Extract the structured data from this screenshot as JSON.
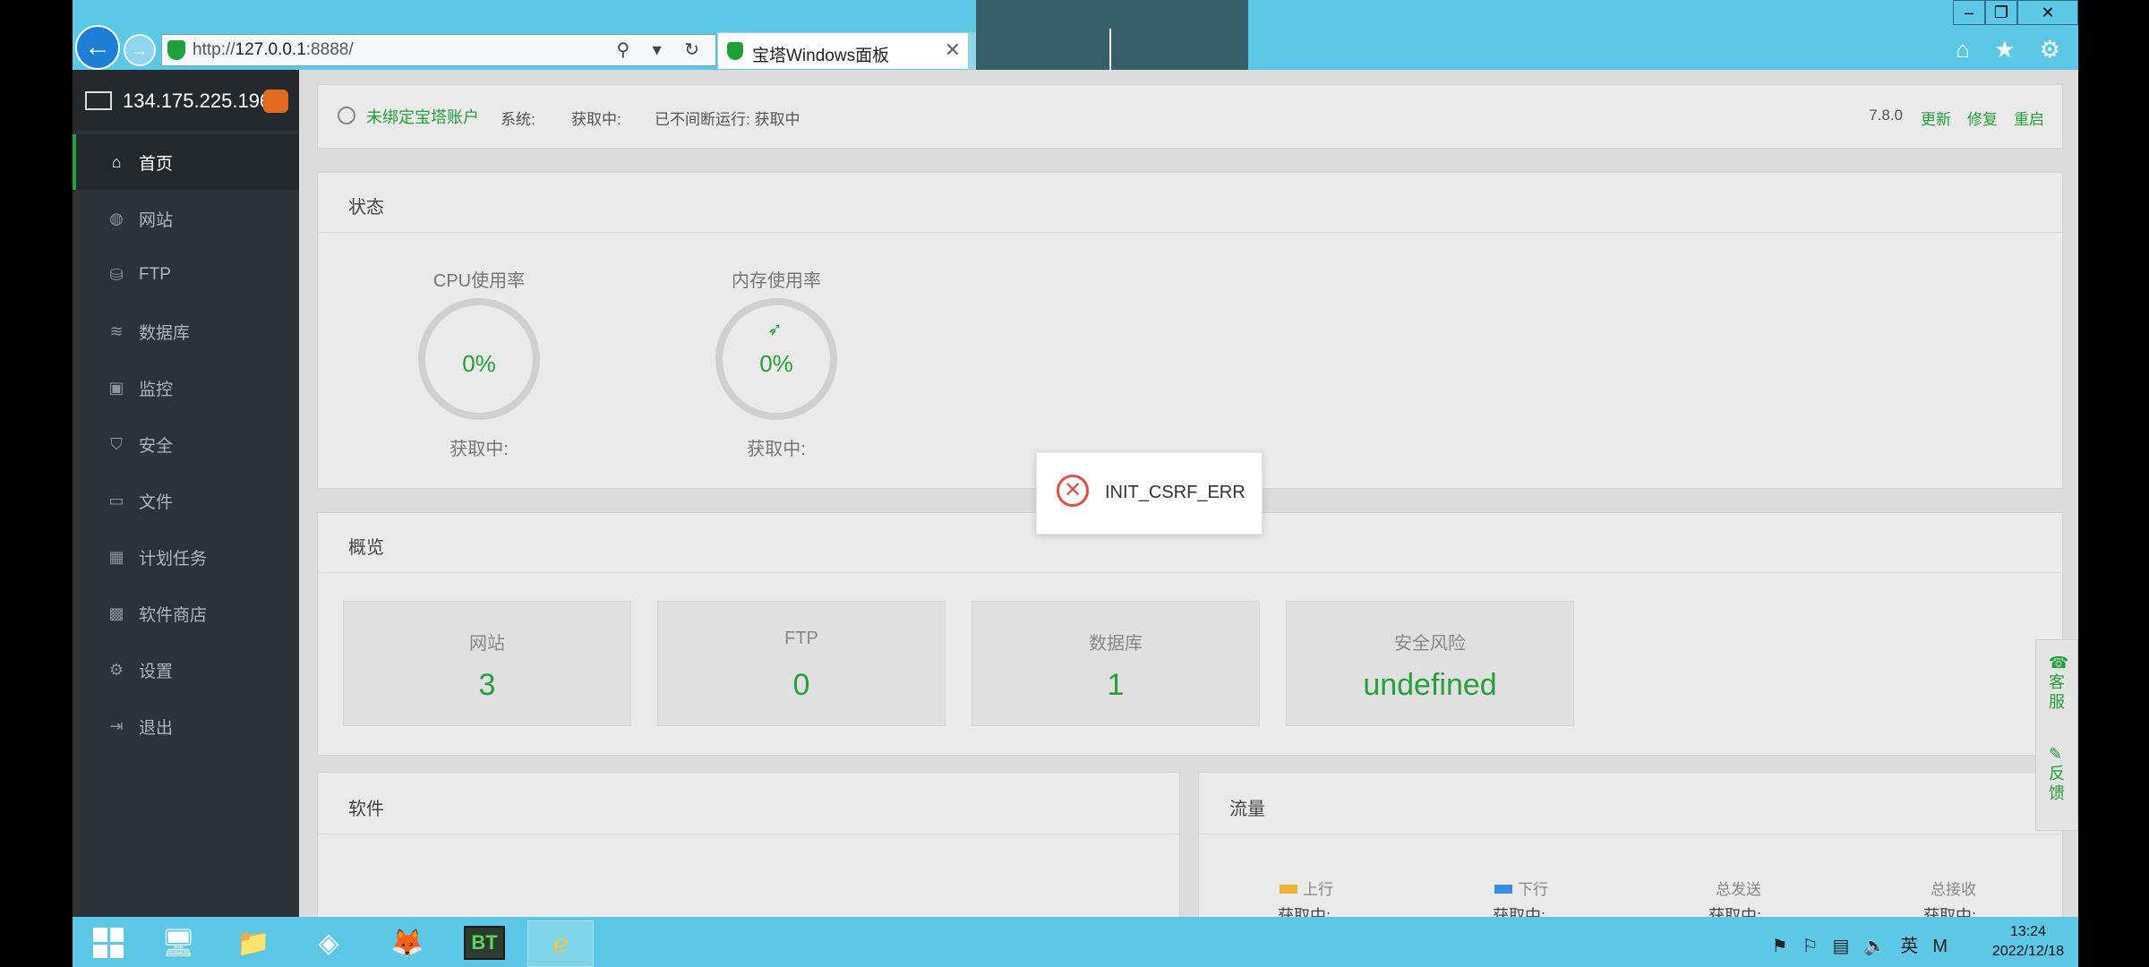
{
  "browser": {
    "url_prefix": "http://",
    "url_host": "127.0.0.1",
    "url_suffix": ":8888/",
    "tab_title": "宝塔Windows面板",
    "tab_close": "✕",
    "address_tools": "⚲ ▾ ↻",
    "window_controls": {
      "minimize": "–",
      "maximize": "❐",
      "close": "✕"
    },
    "right_icons": "⌂ ★ ⚙"
  },
  "sidebar": {
    "ip": "134.175.225.196",
    "items": [
      {
        "label": "首页",
        "icon": "⌂"
      },
      {
        "label": "网站",
        "icon": "◍"
      },
      {
        "label": "FTP",
        "icon": "⛁"
      },
      {
        "label": "数据库",
        "icon": "≋"
      },
      {
        "label": "监控",
        "icon": "▣"
      },
      {
        "label": "安全",
        "icon": "⛉"
      },
      {
        "label": "文件",
        "icon": "▭"
      },
      {
        "label": "计划任务",
        "icon": "▦"
      },
      {
        "label": "软件商店",
        "icon": "▩"
      },
      {
        "label": "设置",
        "icon": "⚙"
      },
      {
        "label": "退出",
        "icon": "⇥"
      }
    ]
  },
  "topbar": {
    "account": "未绑定宝塔账户",
    "system_label": "系统:",
    "system_value": "获取中:",
    "uptime": "已不间断运行: 获取中",
    "version": "7.8.0",
    "update": "更新",
    "repair": "修复",
    "restart": "重启"
  },
  "status": {
    "title": "状态",
    "cpu": {
      "label": "CPU使用率",
      "value": "0%",
      "detail": "获取中:"
    },
    "memory": {
      "label": "内存使用率",
      "value": "0%",
      "detail": "获取中:"
    }
  },
  "overview": {
    "title": "概览",
    "cards": [
      {
        "label": "网站",
        "value": "3"
      },
      {
        "label": "FTP",
        "value": "0"
      },
      {
        "label": "数据库",
        "value": "1"
      },
      {
        "label": "安全风险",
        "value": "undefined"
      }
    ]
  },
  "software": {
    "title": "软件"
  },
  "traffic": {
    "title": "流量",
    "legend": [
      {
        "label": "上行",
        "color": "#f0b33a",
        "value": "获取中:"
      },
      {
        "label": "下行",
        "color": "#3a8ee6",
        "value": "获取中:"
      },
      {
        "label": "总发送",
        "value": "获取中:"
      },
      {
        "label": "总接收",
        "value": "获取中:"
      }
    ]
  },
  "float": {
    "service": "客服",
    "feedback": "反馈"
  },
  "toast": {
    "message": "INIT_CSRF_ERR"
  },
  "taskbar": {
    "bt_label": "BT",
    "tray_ime": "英",
    "tray_m": "M",
    "time": "13:24",
    "date": "2022/12/18"
  },
  "colors": {
    "accent": "#20a53a",
    "sidebar": "#2b3338",
    "error": "#e0504b"
  }
}
